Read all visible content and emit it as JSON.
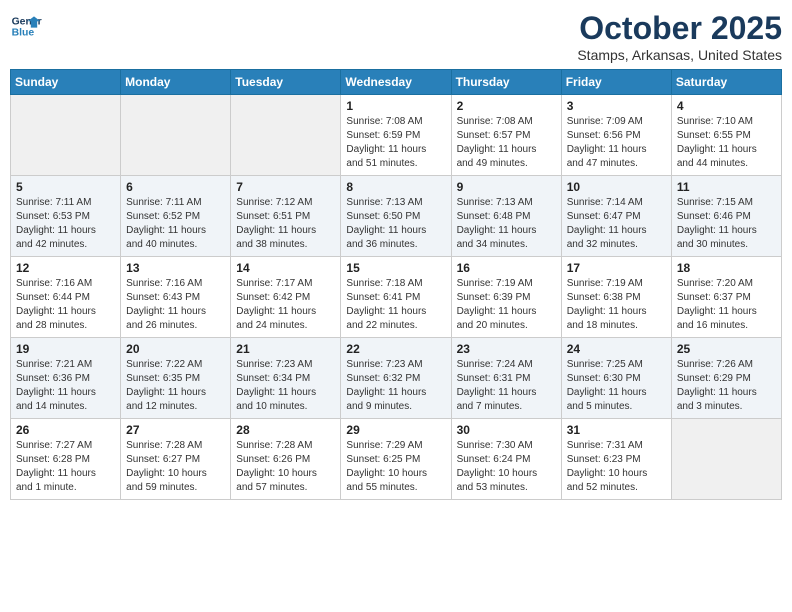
{
  "logo": {
    "line1": "General",
    "line2": "Blue"
  },
  "title": "October 2025",
  "subtitle": "Stamps, Arkansas, United States",
  "weekdays": [
    "Sunday",
    "Monday",
    "Tuesday",
    "Wednesday",
    "Thursday",
    "Friday",
    "Saturday"
  ],
  "weeks": [
    [
      {
        "day": "",
        "sunrise": "",
        "sunset": "",
        "daylight": ""
      },
      {
        "day": "",
        "sunrise": "",
        "sunset": "",
        "daylight": ""
      },
      {
        "day": "",
        "sunrise": "",
        "sunset": "",
        "daylight": ""
      },
      {
        "day": "1",
        "sunrise": "Sunrise: 7:08 AM",
        "sunset": "Sunset: 6:59 PM",
        "daylight": "Daylight: 11 hours and 51 minutes."
      },
      {
        "day": "2",
        "sunrise": "Sunrise: 7:08 AM",
        "sunset": "Sunset: 6:57 PM",
        "daylight": "Daylight: 11 hours and 49 minutes."
      },
      {
        "day": "3",
        "sunrise": "Sunrise: 7:09 AM",
        "sunset": "Sunset: 6:56 PM",
        "daylight": "Daylight: 11 hours and 47 minutes."
      },
      {
        "day": "4",
        "sunrise": "Sunrise: 7:10 AM",
        "sunset": "Sunset: 6:55 PM",
        "daylight": "Daylight: 11 hours and 44 minutes."
      }
    ],
    [
      {
        "day": "5",
        "sunrise": "Sunrise: 7:11 AM",
        "sunset": "Sunset: 6:53 PM",
        "daylight": "Daylight: 11 hours and 42 minutes."
      },
      {
        "day": "6",
        "sunrise": "Sunrise: 7:11 AM",
        "sunset": "Sunset: 6:52 PM",
        "daylight": "Daylight: 11 hours and 40 minutes."
      },
      {
        "day": "7",
        "sunrise": "Sunrise: 7:12 AM",
        "sunset": "Sunset: 6:51 PM",
        "daylight": "Daylight: 11 hours and 38 minutes."
      },
      {
        "day": "8",
        "sunrise": "Sunrise: 7:13 AM",
        "sunset": "Sunset: 6:50 PM",
        "daylight": "Daylight: 11 hours and 36 minutes."
      },
      {
        "day": "9",
        "sunrise": "Sunrise: 7:13 AM",
        "sunset": "Sunset: 6:48 PM",
        "daylight": "Daylight: 11 hours and 34 minutes."
      },
      {
        "day": "10",
        "sunrise": "Sunrise: 7:14 AM",
        "sunset": "Sunset: 6:47 PM",
        "daylight": "Daylight: 11 hours and 32 minutes."
      },
      {
        "day": "11",
        "sunrise": "Sunrise: 7:15 AM",
        "sunset": "Sunset: 6:46 PM",
        "daylight": "Daylight: 11 hours and 30 minutes."
      }
    ],
    [
      {
        "day": "12",
        "sunrise": "Sunrise: 7:16 AM",
        "sunset": "Sunset: 6:44 PM",
        "daylight": "Daylight: 11 hours and 28 minutes."
      },
      {
        "day": "13",
        "sunrise": "Sunrise: 7:16 AM",
        "sunset": "Sunset: 6:43 PM",
        "daylight": "Daylight: 11 hours and 26 minutes."
      },
      {
        "day": "14",
        "sunrise": "Sunrise: 7:17 AM",
        "sunset": "Sunset: 6:42 PM",
        "daylight": "Daylight: 11 hours and 24 minutes."
      },
      {
        "day": "15",
        "sunrise": "Sunrise: 7:18 AM",
        "sunset": "Sunset: 6:41 PM",
        "daylight": "Daylight: 11 hours and 22 minutes."
      },
      {
        "day": "16",
        "sunrise": "Sunrise: 7:19 AM",
        "sunset": "Sunset: 6:39 PM",
        "daylight": "Daylight: 11 hours and 20 minutes."
      },
      {
        "day": "17",
        "sunrise": "Sunrise: 7:19 AM",
        "sunset": "Sunset: 6:38 PM",
        "daylight": "Daylight: 11 hours and 18 minutes."
      },
      {
        "day": "18",
        "sunrise": "Sunrise: 7:20 AM",
        "sunset": "Sunset: 6:37 PM",
        "daylight": "Daylight: 11 hours and 16 minutes."
      }
    ],
    [
      {
        "day": "19",
        "sunrise": "Sunrise: 7:21 AM",
        "sunset": "Sunset: 6:36 PM",
        "daylight": "Daylight: 11 hours and 14 minutes."
      },
      {
        "day": "20",
        "sunrise": "Sunrise: 7:22 AM",
        "sunset": "Sunset: 6:35 PM",
        "daylight": "Daylight: 11 hours and 12 minutes."
      },
      {
        "day": "21",
        "sunrise": "Sunrise: 7:23 AM",
        "sunset": "Sunset: 6:34 PM",
        "daylight": "Daylight: 11 hours and 10 minutes."
      },
      {
        "day": "22",
        "sunrise": "Sunrise: 7:23 AM",
        "sunset": "Sunset: 6:32 PM",
        "daylight": "Daylight: 11 hours and 9 minutes."
      },
      {
        "day": "23",
        "sunrise": "Sunrise: 7:24 AM",
        "sunset": "Sunset: 6:31 PM",
        "daylight": "Daylight: 11 hours and 7 minutes."
      },
      {
        "day": "24",
        "sunrise": "Sunrise: 7:25 AM",
        "sunset": "Sunset: 6:30 PM",
        "daylight": "Daylight: 11 hours and 5 minutes."
      },
      {
        "day": "25",
        "sunrise": "Sunrise: 7:26 AM",
        "sunset": "Sunset: 6:29 PM",
        "daylight": "Daylight: 11 hours and 3 minutes."
      }
    ],
    [
      {
        "day": "26",
        "sunrise": "Sunrise: 7:27 AM",
        "sunset": "Sunset: 6:28 PM",
        "daylight": "Daylight: 11 hours and 1 minute."
      },
      {
        "day": "27",
        "sunrise": "Sunrise: 7:28 AM",
        "sunset": "Sunset: 6:27 PM",
        "daylight": "Daylight: 10 hours and 59 minutes."
      },
      {
        "day": "28",
        "sunrise": "Sunrise: 7:28 AM",
        "sunset": "Sunset: 6:26 PM",
        "daylight": "Daylight: 10 hours and 57 minutes."
      },
      {
        "day": "29",
        "sunrise": "Sunrise: 7:29 AM",
        "sunset": "Sunset: 6:25 PM",
        "daylight": "Daylight: 10 hours and 55 minutes."
      },
      {
        "day": "30",
        "sunrise": "Sunrise: 7:30 AM",
        "sunset": "Sunset: 6:24 PM",
        "daylight": "Daylight: 10 hours and 53 minutes."
      },
      {
        "day": "31",
        "sunrise": "Sunrise: 7:31 AM",
        "sunset": "Sunset: 6:23 PM",
        "daylight": "Daylight: 10 hours and 52 minutes."
      },
      {
        "day": "",
        "sunrise": "",
        "sunset": "",
        "daylight": ""
      }
    ]
  ]
}
